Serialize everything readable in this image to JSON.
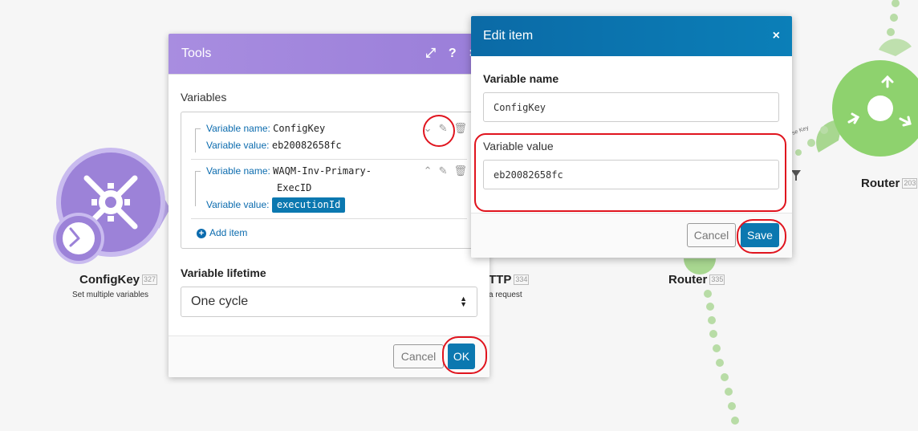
{
  "canvas": {
    "nodes": [
      {
        "label": "ConfigKey",
        "id": "327",
        "subtitle": "Set multiple variables"
      },
      {
        "label": "TTP",
        "id": "334",
        "subtitle": "a request"
      },
      {
        "label": "Router",
        "id": "335"
      },
      {
        "label": "Router",
        "id": "203"
      }
    ],
    "connector_label": "se Key"
  },
  "tools_dialog": {
    "title": "Tools",
    "variables_label": "Variables",
    "items": [
      {
        "name_label": "Variable name:",
        "name_value": "ConfigKey",
        "value_label": "Variable value:",
        "value": "eb20082658fc"
      },
      {
        "name_label": "Variable name:",
        "name_value_line1": "WAQM-Inv-Primary-",
        "name_value_line2": "ExecID",
        "value_label": "Variable value:",
        "value_pill": "executionId"
      }
    ],
    "add_item_label": "Add item",
    "lifetime_label": "Variable lifetime",
    "lifetime_value": "One cycle",
    "cancel_label": "Cancel",
    "ok_label": "OK"
  },
  "edit_dialog": {
    "title": "Edit item",
    "close_glyph": "×",
    "name_label": "Variable name",
    "name_value": "ConfigKey",
    "value_label": "Variable value",
    "value_value": "eb20082658fc",
    "cancel_label": "Cancel",
    "save_label": "Save"
  },
  "colors": {
    "tools_header": "#9a7ed9",
    "edit_header": "#0b78b0",
    "primary_button": "#0b78b0",
    "highlight": "#e0141e",
    "tools_module": "#9c82d8",
    "router_module": "#8ed26e"
  }
}
